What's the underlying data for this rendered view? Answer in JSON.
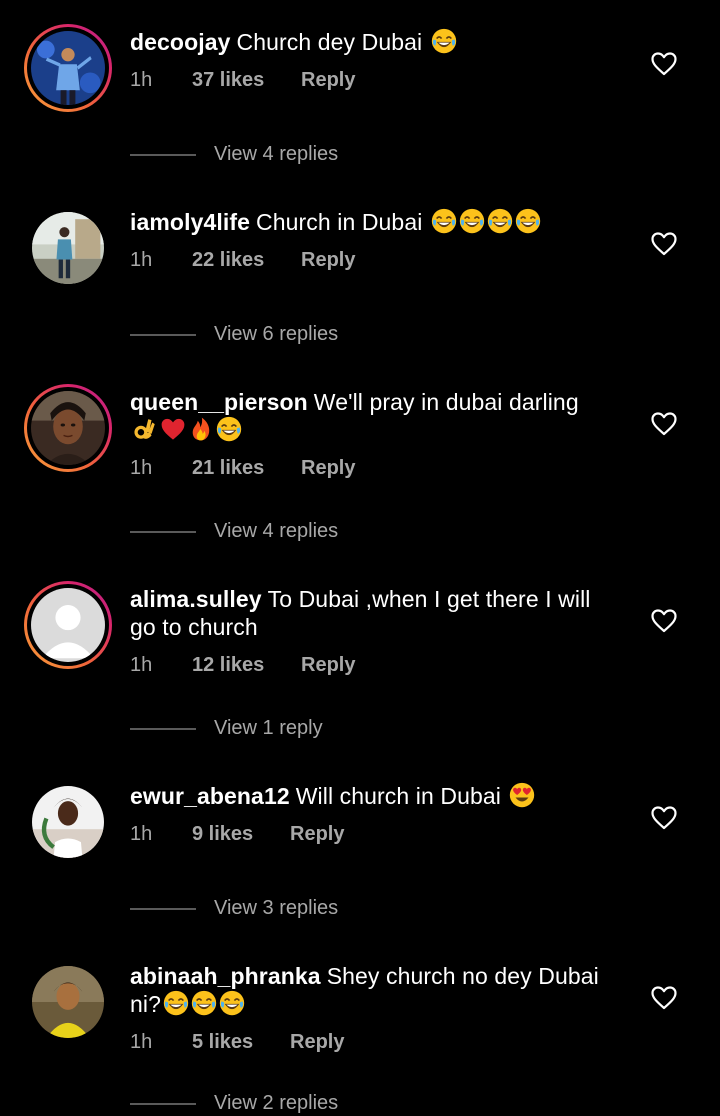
{
  "comments": [
    {
      "username": "decoojay",
      "text": "Church dey Dubai",
      "emojis": [
        "joy"
      ],
      "time": "1h",
      "likes": "37 likes",
      "reply": "Reply",
      "view_replies": "View 4 replies",
      "story_ring": true,
      "avatar": "performer-photo"
    },
    {
      "username": "iamoly4life",
      "text": "Church in Dubai",
      "emojis": [
        "joy",
        "joy",
        "joy",
        "joy"
      ],
      "time": "1h",
      "likes": "22 likes",
      "reply": "Reply",
      "view_replies": "View 6 replies",
      "story_ring": false,
      "avatar": "outdoor-photo"
    },
    {
      "username": "queen__pierson",
      "text": "We'll pray in dubai darling",
      "emojis": [
        "ok-hand",
        "heart",
        "fire",
        "joy"
      ],
      "time": "1h",
      "likes": "21 likes",
      "reply": "Reply",
      "view_replies": "View 4 replies",
      "story_ring": true,
      "avatar": "portrait-photo"
    },
    {
      "username": "alima.sulley",
      "text": "To Dubai ,when I get there I will go to church",
      "emojis": [],
      "time": "1h",
      "likes": "12 likes",
      "reply": "Reply",
      "view_replies": "View 1 reply",
      "story_ring": true,
      "avatar": "default-avatar"
    },
    {
      "username": "ewur_abena12",
      "text": "Will church in Dubai",
      "emojis": [
        "heart-eyes"
      ],
      "time": "1h",
      "likes": "9 likes",
      "reply": "Reply",
      "view_replies": "View 3 replies",
      "story_ring": false,
      "avatar": "portrait-photo"
    },
    {
      "username": "abinaah_phranka",
      "text": "Shey church no dey Dubai ni?",
      "emojis": [
        "joy",
        "joy",
        "joy"
      ],
      "time": "1h",
      "likes": "5 likes",
      "reply": "Reply",
      "view_replies": "View 2 replies",
      "story_ring": false,
      "avatar": "portrait-photo"
    }
  ],
  "colors": {
    "background": "#000000",
    "text": "#ffffff",
    "secondary_text": "#a8a8a8",
    "story_ring_start": "#f9a23b",
    "story_ring_end": "#b21f8f"
  },
  "icons": {
    "like": "heart-outline-icon"
  }
}
